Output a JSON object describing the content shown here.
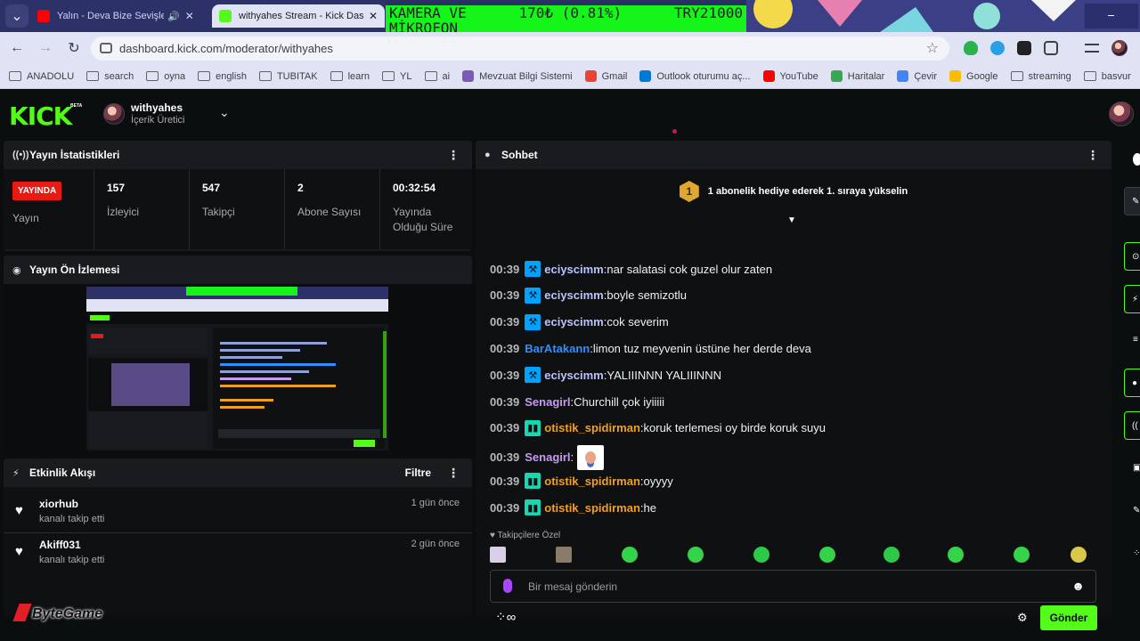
{
  "browser": {
    "tabs": [
      {
        "title": "Yalın - Deva Bize Sevişler (C",
        "icon": "youtube-icon",
        "audio": "speaker-icon",
        "close": "✕"
      },
      {
        "title": "withyahes Stream - Kick Dashb",
        "icon": "kick-icon",
        "close": "✕"
      }
    ],
    "overlay": {
      "line1_left": "KAMERA VE",
      "line1_mid": "170₺ (0.81%)",
      "line1_right": "TRY21000",
      "line2": "MİKROFON"
    },
    "url": "dashboard.kick.com/moderator/withyahes",
    "bookmarks": [
      {
        "label": "ANADOLU"
      },
      {
        "label": "search"
      },
      {
        "label": "oyna"
      },
      {
        "label": "english"
      },
      {
        "label": "TUBITAK"
      },
      {
        "label": "learn"
      },
      {
        "label": "YL"
      },
      {
        "label": "ai"
      },
      {
        "label": "Mevzuat Bilgi Sistemi"
      },
      {
        "label": "Gmail"
      },
      {
        "label": "Outlook oturumu aç..."
      },
      {
        "label": "YouTube"
      },
      {
        "label": "Haritalar"
      },
      {
        "label": "Çevir"
      },
      {
        "label": "Google"
      },
      {
        "label": "streaming"
      },
      {
        "label": "basvur"
      }
    ]
  },
  "header": {
    "logo": "KICK",
    "beta": "BETA",
    "channel_name": "withyahes",
    "channel_role": "İçerik Üretici",
    "accent": "#53fc18"
  },
  "stats_panel": {
    "title": "Yayın İstatistikleri",
    "live_badge": "YAYINDA",
    "live_label": "Yayın",
    "items": [
      {
        "value": "157",
        "label": "İzleyici"
      },
      {
        "value": "547",
        "label": "Takipçi"
      },
      {
        "value": "2",
        "label": "Abone Sayısı"
      },
      {
        "value": "00:32:54",
        "label": "Yayında Olduğu Süre"
      }
    ]
  },
  "preview_panel": {
    "title": "Yayın Ön İzlemesi"
  },
  "activity_panel": {
    "title": "Etkinlik Akışı",
    "filter": "Filtre",
    "items": [
      {
        "user": "xiorhub",
        "action": "kanalı takip etti",
        "time": "1 gün önce"
      },
      {
        "user": "Akiff031",
        "action": "kanalı takip etti",
        "time": "2 gün önce"
      }
    ]
  },
  "chat_panel": {
    "title": "Sohbet",
    "banner_rank": "1",
    "banner_text": "1 abonelik hediye ederek 1. sıraya yükselin",
    "messages": [
      {
        "time": "00:39",
        "badge": "mod",
        "user": "eciyscimm",
        "color": "#b9c4ff",
        "text": "nar salatasi cok guzel olur zaten"
      },
      {
        "time": "00:39",
        "badge": "mod",
        "user": "eciyscimm",
        "color": "#b9c4ff",
        "text": "boyle semizotlu"
      },
      {
        "time": "00:39",
        "badge": "mod",
        "user": "eciyscimm",
        "color": "#b9c4ff",
        "text": "cok severim"
      },
      {
        "time": "00:39",
        "badge": "",
        "user": "BarAtakann",
        "color": "#2f8fff",
        "text": "limon tuz meyvenin üstüne her derde deva"
      },
      {
        "time": "00:39",
        "badge": "mod",
        "user": "eciyscimm",
        "color": "#b9c4ff",
        "text": "YALIIINNN YALIIINNN"
      },
      {
        "time": "00:39",
        "badge": "",
        "user": "Senagirl",
        "color": "#c79bf2",
        "text": "Churchill çok iyiiiii"
      },
      {
        "time": "00:39",
        "badge": "sub",
        "user": "otistik_spidirman",
        "color": "#f0a020",
        "text": "koruk terlemesi oy birde koruk suyu"
      },
      {
        "time": "00:39",
        "badge": "",
        "user": "Senagirl",
        "color": "#c79bf2",
        "text": "",
        "sticker": true
      },
      {
        "time": "00:39",
        "badge": "sub",
        "user": "otistik_spidirman",
        "color": "#f0a020",
        "text": "oyyyy"
      },
      {
        "time": "00:39",
        "badge": "sub",
        "user": "otistik_spidirman",
        "color": "#f0a020",
        "text": "he"
      }
    ],
    "followers_only": "Takipçilere Özel",
    "input_placeholder": "Bir mesaj gönderin",
    "send_label": "Gönder"
  },
  "watermark": "ByteGame"
}
